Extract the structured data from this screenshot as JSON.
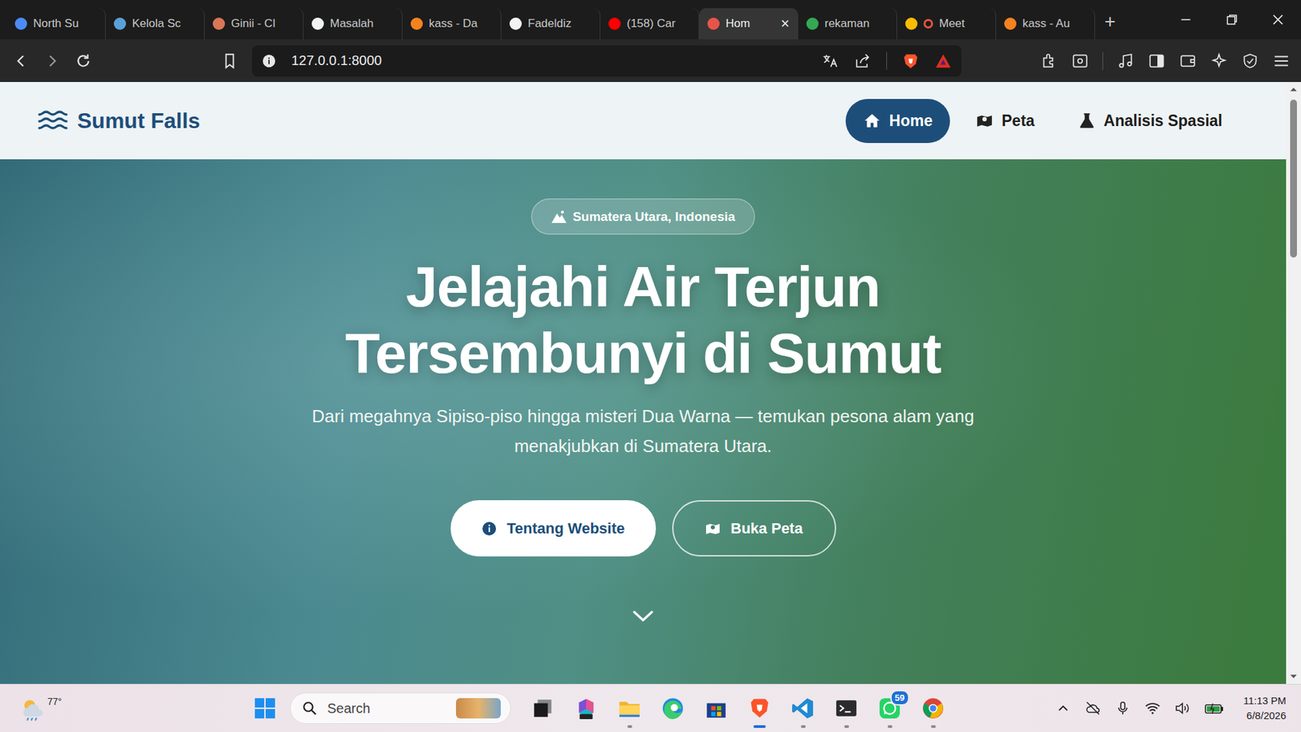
{
  "browser": {
    "tabs": [
      {
        "label": "North Su",
        "selected": false,
        "recording": false,
        "color": "#4c8bf5"
      },
      {
        "label": "Kelola Sc",
        "selected": false,
        "recording": false,
        "color": "#5aa0d8"
      },
      {
        "label": "Ginii - Cl",
        "selected": false,
        "recording": false,
        "color": "#d97757"
      },
      {
        "label": "Masalah",
        "selected": false,
        "recording": false,
        "color": "#f2f2f2"
      },
      {
        "label": "kass - Da",
        "selected": false,
        "recording": false,
        "color": "#f5821f"
      },
      {
        "label": "Fadeldiz",
        "selected": false,
        "recording": false,
        "color": "#f2f2f2"
      },
      {
        "label": "(158) Car",
        "selected": false,
        "recording": false,
        "color": "#ff0000"
      },
      {
        "label": "Hom",
        "selected": true,
        "recording": false,
        "color": "#e8544a"
      },
      {
        "label": "rekaman",
        "selected": false,
        "recording": false,
        "color": "#34a853"
      },
      {
        "label": "Meet",
        "selected": false,
        "recording": true,
        "color": "#fbbc04"
      },
      {
        "label": "kass - Au",
        "selected": false,
        "recording": false,
        "color": "#f5821f"
      }
    ],
    "close_tab": "×",
    "new_tab": "+",
    "url": "127.0.0.1:8000"
  },
  "site": {
    "logo": "Sumut Falls",
    "nav": [
      {
        "label": "Home",
        "selected": true,
        "kind": "home"
      },
      {
        "label": "Peta",
        "selected": false,
        "kind": "map"
      },
      {
        "label": "Analisis Spasial",
        "selected": false,
        "kind": "lab"
      }
    ]
  },
  "hero": {
    "badge": "Sumatera Utara, Indonesia",
    "title_lines": [
      "Jelajahi Air Terjun",
      "Tersembunyi di Sumut"
    ],
    "subtitle": "Dari megahnya Sipiso-piso hingga misteri Dua Warna — temukan pesona alam yang menakjubkan di Sumatera Utara.",
    "buttons": [
      {
        "label": "Tentang Website",
        "kind": "primary"
      },
      {
        "label": "Buka Peta",
        "kind": "outline"
      }
    ]
  },
  "taskbar": {
    "weather": "77°",
    "search_placeholder": "Search",
    "apps": [
      {
        "kind": "taskview",
        "running": false,
        "active": false,
        "badge": ""
      },
      {
        "kind": "m365",
        "running": false,
        "active": false,
        "badge": ""
      },
      {
        "kind": "explorer",
        "running": true,
        "active": false,
        "badge": ""
      },
      {
        "kind": "edge",
        "running": false,
        "active": false,
        "badge": ""
      },
      {
        "kind": "store",
        "running": false,
        "active": false,
        "badge": ""
      },
      {
        "kind": "brave",
        "running": true,
        "active": true,
        "badge": ""
      },
      {
        "kind": "vscode",
        "running": true,
        "active": false,
        "badge": ""
      },
      {
        "kind": "terminal",
        "running": true,
        "active": false,
        "badge": ""
      },
      {
        "kind": "whatsapp",
        "running": true,
        "active": false,
        "badge": "59"
      },
      {
        "kind": "chrome",
        "running": true,
        "active": false,
        "badge": ""
      }
    ],
    "time": "11:13 PM",
    "date": "6/8/2026"
  }
}
